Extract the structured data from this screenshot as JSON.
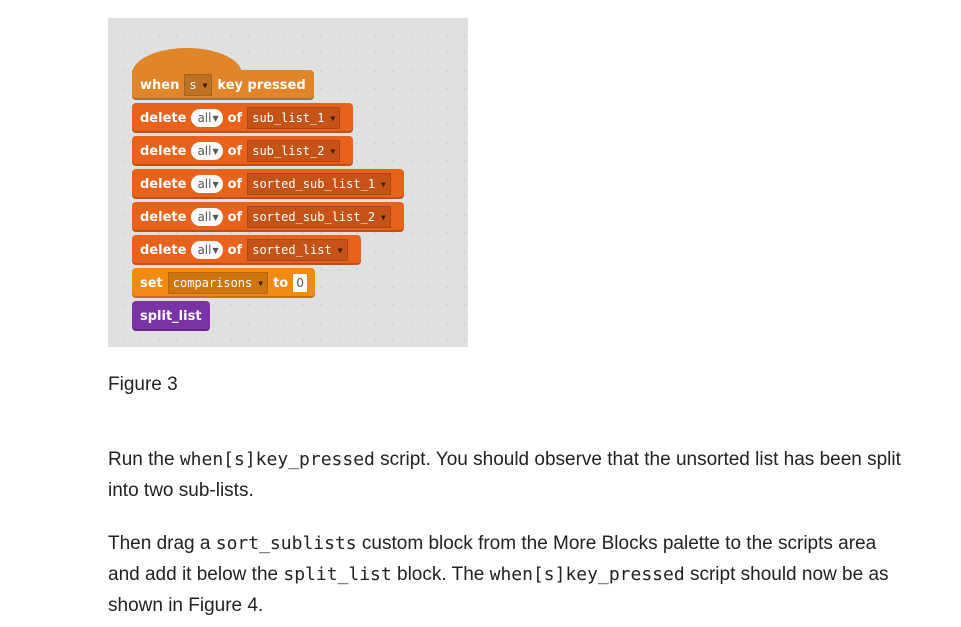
{
  "figure": {
    "hat_block": {
      "when": "when",
      "key_value": "s",
      "key_pressed": "key pressed"
    },
    "delete_blocks": [
      {
        "verb": "delete",
        "item": "all",
        "of": "of",
        "list": "sub_list_1"
      },
      {
        "verb": "delete",
        "item": "all",
        "of": "of",
        "list": "sub_list_2"
      },
      {
        "verb": "delete",
        "item": "all",
        "of": "of",
        "list": "sorted_sub_list_1"
      },
      {
        "verb": "delete",
        "item": "all",
        "of": "of",
        "list": "sorted_sub_list_2"
      },
      {
        "verb": "delete",
        "item": "all",
        "of": "of",
        "list": "sorted_list"
      }
    ],
    "set_block": {
      "verb": "set",
      "variable": "comparisons",
      "to": "to",
      "value": "0"
    },
    "custom_block": {
      "label": "split_list"
    },
    "colors": {
      "events": "#e0852a",
      "lists": "#e8621c",
      "variables": "#f18a12",
      "more_blocks": "#7a33a6"
    },
    "caption": "Figure 3"
  },
  "paragraphs": [
    {
      "t1": "Run the ",
      "c1": "when[s]key_pressed",
      "t2": " script. You should observe that the unsorted list has been split into two sub-lists."
    },
    {
      "t1": "Then drag a ",
      "c1": "sort_sublists",
      "t2": " custom block from the More Blocks palette to the scripts area and add it below the ",
      "c2": "split_list",
      "t3": " block. The ",
      "c3": "when[s]key_pressed",
      "t4": " script should now be as shown in Figure 4."
    }
  ]
}
